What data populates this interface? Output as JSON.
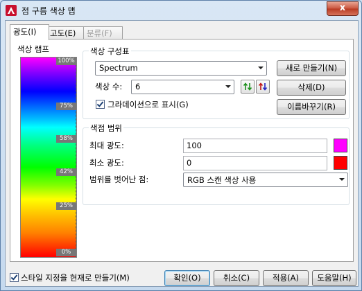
{
  "window": {
    "title": "점 구름 색상 맵",
    "close_glyph": "x"
  },
  "tabs": [
    {
      "label": "광도(I)"
    },
    {
      "label": "고도(E)"
    },
    {
      "label": "분류(F)"
    }
  ],
  "color_ramp": {
    "title": "색상 램프",
    "ticks": [
      "100%",
      "75%",
      "58%",
      "42%",
      "25%",
      "0%"
    ]
  },
  "color_scheme": {
    "title": "색상 구성표",
    "scheme_value": "Spectrum",
    "new_button": "새로 만들기(N)",
    "delete_button": "삭제(D)",
    "rename_button": "이름바꾸기(R)",
    "count_label": "색상 수:",
    "count_value": "6",
    "gradient_label": "그라데이션으로 표시(G)",
    "gradient_checked": true
  },
  "color_range": {
    "title": "색점 범위",
    "max_label": "최대 광도:",
    "max_value": "100",
    "max_color": "#ff00ff",
    "min_label": "최소 광도:",
    "min_value": "0",
    "min_color": "#ff0000",
    "out_label": "범위를 벗어난 점:",
    "out_value": "RGB 스캔 색상 사용"
  },
  "footer": {
    "set_current_label": "스타일 지정을 현재로 만들기(M)",
    "set_current_checked": true,
    "ok": "확인(O)",
    "cancel": "취소(C)",
    "apply": "적용(A)",
    "help": "도움말(H)"
  }
}
